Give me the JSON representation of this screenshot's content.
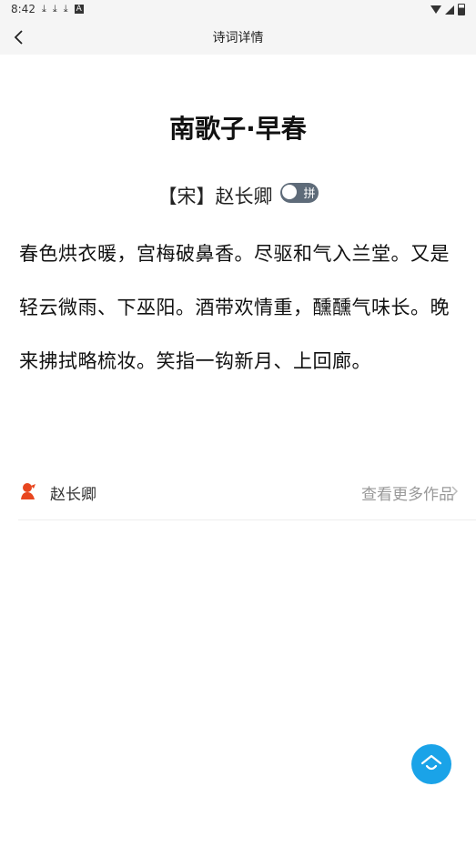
{
  "status": {
    "time": "8:42",
    "icons_left": [
      "download-icon",
      "download-icon",
      "download-icon",
      "a-icon"
    ],
    "icons_right": [
      "wifi-icon",
      "signal-icon",
      "battery-icon"
    ]
  },
  "header": {
    "title": "诗词详情",
    "back_icon": "chevron-left-icon"
  },
  "poem": {
    "title": "南歌子·早春",
    "dynasty": "【宋】",
    "author": "赵长卿",
    "pinyin_label": "拼",
    "body": "春色烘衣暖，宫梅破鼻香。尽驱和气入兰堂。又是轻云微雨、下巫阳。酒带欢情重，醺醺气味长。晚来拂拭略梳妆。笑指一钩新月、上回廊。"
  },
  "author_row": {
    "name": "赵长卿",
    "more_label": "查看更多作品"
  },
  "colors": {
    "accent": "#1aa3e8",
    "author_icon": "#e8461f",
    "toggle": "#5e6b79"
  }
}
